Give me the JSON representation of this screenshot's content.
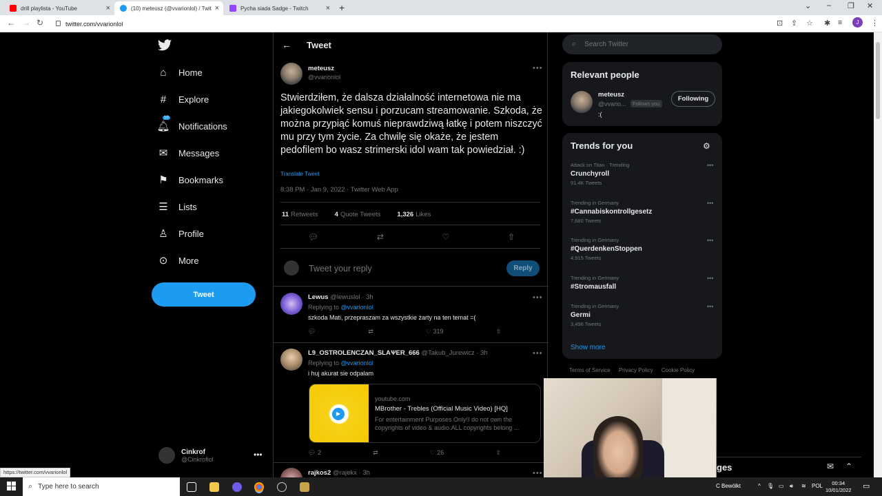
{
  "browser": {
    "tabs": [
      {
        "title": "drill playlista - YouTube",
        "color": "#ff0000"
      },
      {
        "title": "(10) meteusz (@vvarionlol) / Twit",
        "color": "#1d9bf0"
      },
      {
        "title": "Pycha siada Sadge - Twitch",
        "color": "#9146ff"
      }
    ],
    "url": "twitter.com/vvarionlol",
    "profile_initial": "J",
    "status_url": "https://twitter.com/vvarionlol"
  },
  "nav": {
    "items": [
      {
        "label": "Home",
        "icon": "home-icon"
      },
      {
        "label": "Explore",
        "icon": "hashtag-icon"
      },
      {
        "label": "Notifications",
        "icon": "bell-icon",
        "badge": "10"
      },
      {
        "label": "Messages",
        "icon": "mail-icon"
      },
      {
        "label": "Bookmarks",
        "icon": "bookmark-icon"
      },
      {
        "label": "Lists",
        "icon": "list-icon"
      },
      {
        "label": "Profile",
        "icon": "person-icon"
      },
      {
        "label": "More",
        "icon": "more-circle-icon"
      }
    ],
    "tweet_button": "Tweet",
    "account": {
      "name": "Cinkrof",
      "handle": "@Cinkrofiol"
    }
  },
  "header": {
    "title": "Tweet"
  },
  "tweet": {
    "author_name": "meteusz",
    "author_handle": "@vvarionlol",
    "text": "Stwierdziłem, że dalsza działalność internetowa nie ma jakiegokolwiek sensu i porzucam streamowanie. Szkoda, że można przypiąć komuś nieprawdziwą łatkę i potem niszczyć mu przy tym życie. Za chwilę się okaże, że jestem pedofilem bo wasz strimerski idol wam tak powiedział. :)",
    "translate": "Translate Tweet",
    "time": "8:38 PM · Jan 9, 2022 · Twitter Web App",
    "retweets_count": "11",
    "retweets_label": "Retweets",
    "quotes_count": "4",
    "quotes_label": "Quote Tweets",
    "likes_count": "1,326",
    "likes_label": "Likes"
  },
  "reply_box": {
    "placeholder": "Tweet your reply",
    "button": "Reply"
  },
  "replies": [
    {
      "name": "Lewus",
      "handle": "@lewuslol · 3h",
      "replying_prefix": "Replying to",
      "replying_to": "@vvarionlol",
      "text": "szkoda Mati, przepraszam za wszystkie żarty na ten temat =(",
      "likes": "319"
    },
    {
      "name": "L9_OSTROLENCZAN_SLAѰER_666",
      "handle": "@Takub_Jurewicz · 3h",
      "replying_prefix": "Replying to",
      "replying_to": "@vvarionlol",
      "text": "i huj akurat sie odpalam",
      "card": {
        "domain": "youtube.com",
        "title": "MBrother - Trebles (Official Music Video) [HQ]",
        "description": "For entertainment Purposes Only!I do not own the copyrights of video & audio.ALL copyrights belong ..."
      },
      "replies": "2",
      "likes": "26"
    },
    {
      "name": "rajkos2",
      "handle": "@rajekx · 3h"
    }
  ],
  "sidebar": {
    "search_placeholder": "Search Twitter",
    "relevant_title": "Relevant people",
    "person": {
      "name": "meteusz",
      "handle": "@vvario...",
      "follows_you": "Follows you",
      "bio": ":(",
      "button": "Following"
    },
    "trends_title": "Trends for you",
    "trends": [
      {
        "context": "Attack on Titan · Trending",
        "title": "Crunchyroll",
        "count": "91.4K Tweets"
      },
      {
        "context": "Trending in Germany",
        "title": "#Cannabiskontrollgesetz",
        "count": "7,680 Tweets"
      },
      {
        "context": "Trending in Germany",
        "title": "#QuerdenkenStoppen",
        "count": "4,915 Tweets"
      },
      {
        "context": "Trending in Germany",
        "title": "#Stromausfall",
        "count": ""
      },
      {
        "context": "Trending in Germany",
        "title": "Germi",
        "count": "3,496 Tweets"
      }
    ],
    "show_more": "Show more",
    "footer": [
      "Terms of Service",
      "Privacy Policy",
      "Cookie Policy"
    ]
  },
  "messages_bar": {
    "title": "ges"
  },
  "taskbar": {
    "search": "Type here to search",
    "weather": "C Bewölkt",
    "lang": "POL",
    "time": "00:34",
    "date": "10/01/2022"
  },
  "colors": {
    "accent": "#1d9bf0",
    "background": "#000000",
    "muted": "#71767b"
  }
}
